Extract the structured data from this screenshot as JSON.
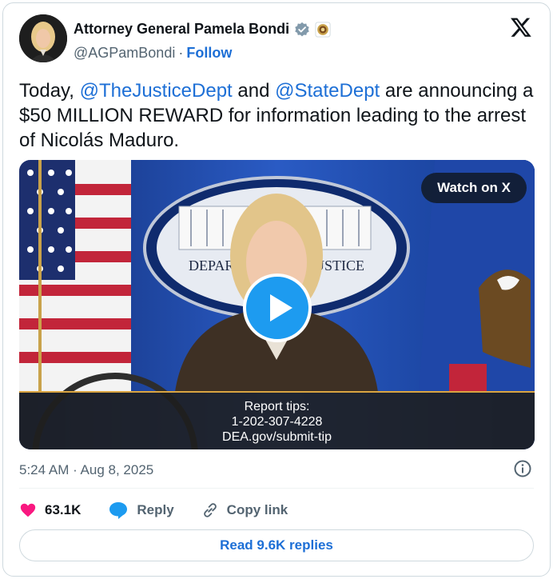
{
  "author": {
    "name": "Attorney General Pamela Bondi",
    "handle": "@AGPamBondi",
    "separator": "·",
    "follow_label": "Follow"
  },
  "tweet": {
    "text_before_1": "Today, ",
    "mention_1": "@TheJusticeDept",
    "text_between": " and ",
    "mention_2": "@StateDept",
    "text_after": " are announcing a $50 MILLION REWARD for information leading to the arrest of Nicolás Maduro."
  },
  "media": {
    "watch_label": "Watch on X",
    "seal_text": "DEPARTMENT OF JUSTICE",
    "caption_lines": [
      "Report tips:",
      "1-202-307-4228",
      "DEA.gov/submit-tip"
    ]
  },
  "meta": {
    "timestamp": "5:24 AM · Aug 8, 2025"
  },
  "actions": {
    "likes_count": "63.1K",
    "reply_label": "Reply",
    "copy_label": "Copy link"
  },
  "footer": {
    "read_replies_label": "Read 9.6K replies"
  },
  "colors": {
    "link_blue": "#1d6fd6",
    "like_pink": "#f91880",
    "play_blue": "#1d9bf0"
  },
  "icons": [
    "verified-badge-icon",
    "government-affiliation-icon",
    "x-logo-icon",
    "play-icon",
    "info-icon",
    "heart-icon",
    "reply-bubble-icon",
    "link-icon"
  ]
}
